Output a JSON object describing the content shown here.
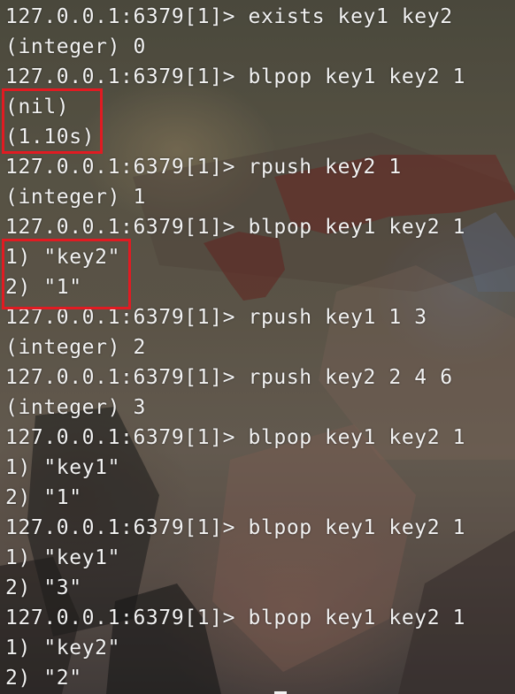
{
  "terminal": {
    "lines": [
      "127.0.0.1:6379[1]> exists key1 key2",
      "(integer) 0",
      "127.0.0.1:6379[1]> blpop key1 key2 1",
      "(nil)",
      "(1.10s)",
      "127.0.0.1:6379[1]> rpush key2 1",
      "(integer) 1",
      "127.0.0.1:6379[1]> blpop key1 key2 1",
      "1) \"key2\"",
      "2) \"1\"",
      "127.0.0.1:6379[1]> rpush key1 1 3",
      "(integer) 2",
      "127.0.0.1:6379[1]> rpush key2 2 4 6",
      "(integer) 3",
      "127.0.0.1:6379[1]> blpop key1 key2 1",
      "1) \"key1\"",
      "2) \"1\"",
      "127.0.0.1:6379[1]> blpop key1 key2 1",
      "1) \"key1\"",
      "2) \"3\"",
      "127.0.0.1:6379[1]> blpop key1 key2 1",
      "1) \"key2\"",
      "2) \"2\""
    ]
  },
  "colors": {
    "text": "#f2f2f2",
    "highlight_border": "#e11b22"
  }
}
